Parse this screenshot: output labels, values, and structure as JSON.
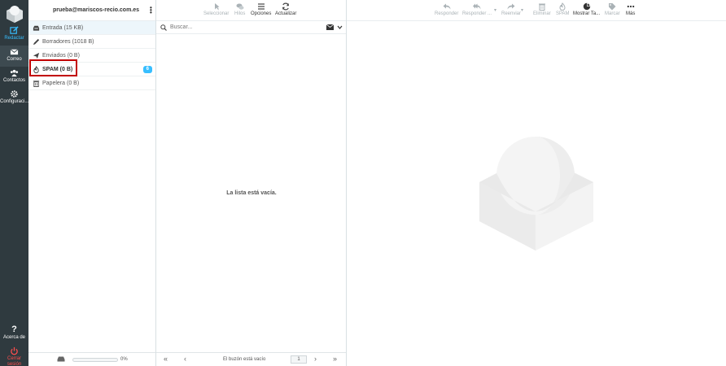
{
  "nav": {
    "compose": "Redactar",
    "mail": "Correo",
    "contacts": "Contactos",
    "settings": "Configuraci...",
    "about": "Acerca de",
    "logout": "Cerrar sesión"
  },
  "account": {
    "email": "prueba@mariscos-recio.com.es"
  },
  "folders": [
    {
      "label": "Entrada",
      "size": "(15 KB)"
    },
    {
      "label": "Borradores",
      "size": "(1018 B)"
    },
    {
      "label": "Enviados",
      "size": "(0 B)"
    },
    {
      "label": "SPAM",
      "size": "(0 B)",
      "badge": "6"
    },
    {
      "label": "Papelera",
      "size": "(0 B)"
    }
  ],
  "quota": {
    "percent": "0%"
  },
  "list_toolbar": {
    "select": "Seleccionar",
    "threads": "Hilos",
    "options": "Opciones",
    "refresh": "Actualizar"
  },
  "search": {
    "placeholder": "Buscar..."
  },
  "list": {
    "empty": "La lista está vacía.",
    "count": "El buzón está vacío",
    "page": "1"
  },
  "preview_toolbar": {
    "reply": "Responder",
    "reply_all": "Responder ...",
    "forward": "Reenviar",
    "delete": "Eliminar",
    "spam": "SPAM",
    "show_tags": "Mostrar Ta...",
    "mark": "Marcar",
    "more": "Más"
  },
  "colors": {
    "accent": "#37beff",
    "nav_bg": "#2f3a3f",
    "highlight": "#c20000"
  }
}
